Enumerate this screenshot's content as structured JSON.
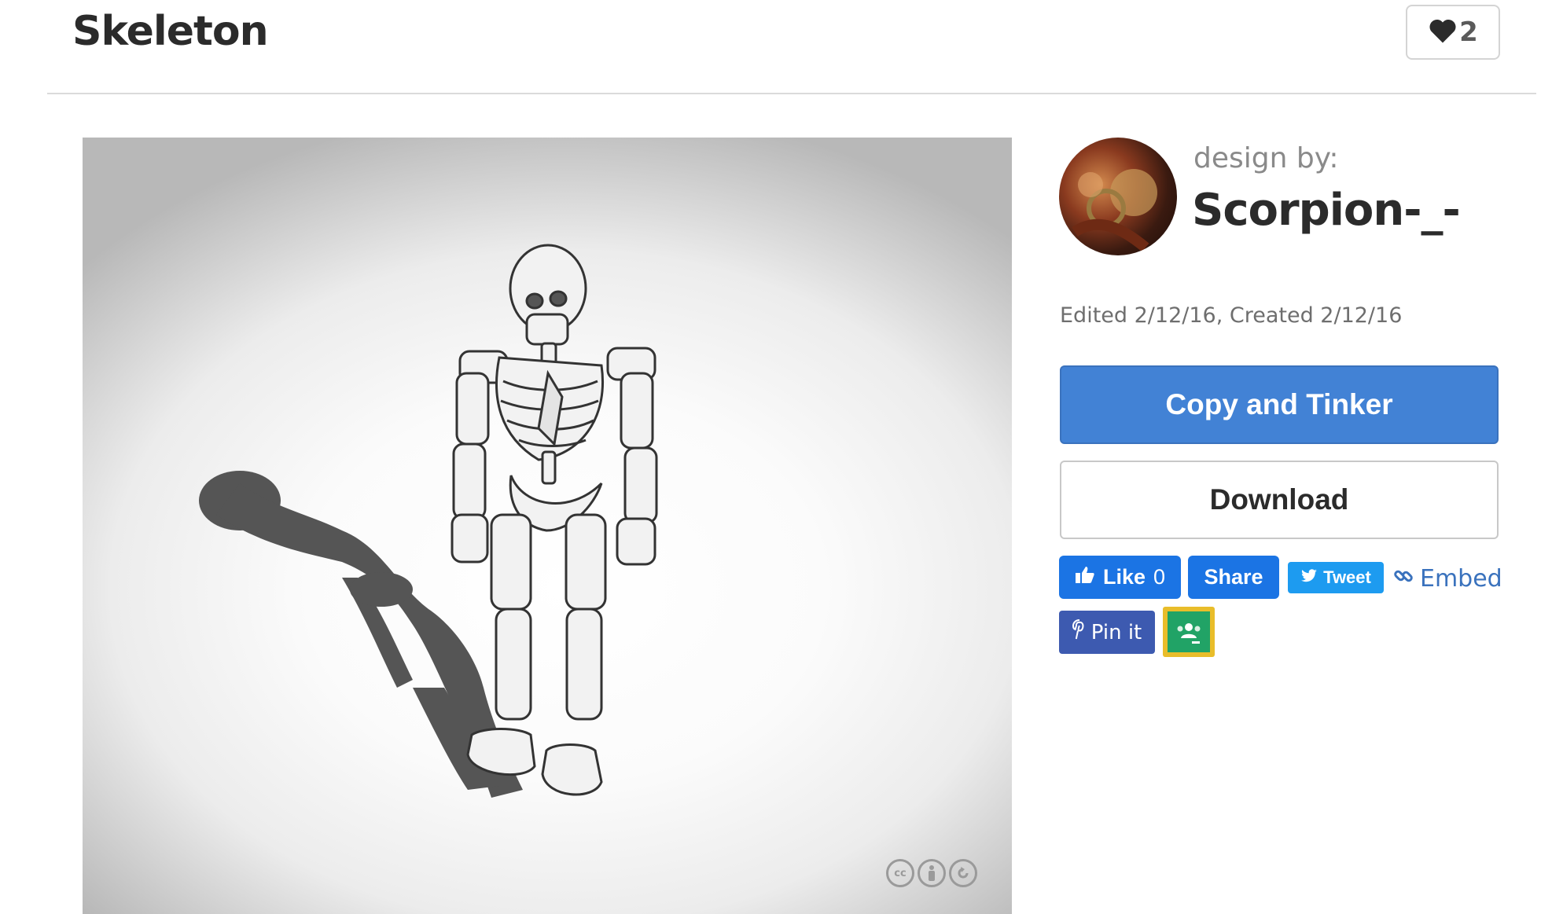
{
  "header": {
    "title": "Skeleton",
    "like_count": "2"
  },
  "viewer": {
    "image_subject": "skeleton-model",
    "license_icons": [
      "cc-icon",
      "attribution-icon",
      "share-alike-icon"
    ],
    "license_text": [
      "cc"
    ]
  },
  "designer": {
    "label": "design by:",
    "name": "Scorpion-_-"
  },
  "meta": {
    "dates": "Edited 2/12/16, Created 2/12/16"
  },
  "actions": {
    "copy_label": "Copy and Tinker",
    "download_label": "Download"
  },
  "social": {
    "fb_like_label": "Like",
    "fb_like_count": "0",
    "fb_share_label": "Share",
    "tweet_label": "Tweet",
    "embed_label": "Embed",
    "pin_label": "Pin it"
  },
  "colors": {
    "primary": "#4282d5",
    "facebook": "#1b74e4",
    "twitter": "#1d9bf0",
    "pinterest": "#3d5ab0",
    "classroom": "#21a366",
    "classroom_border": "#e9bd2a"
  }
}
